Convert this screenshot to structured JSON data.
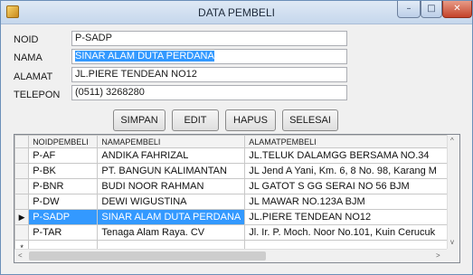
{
  "window": {
    "title": "DATA PEMBELI",
    "min_glyph": "–",
    "max_glyph": "□",
    "close_glyph": "✕",
    "icon": "form-icon"
  },
  "form": {
    "noid_label": "NOID",
    "noid_value": "P-SADP",
    "nama_label": "NAMA",
    "nama_value": "SINAR ALAM DUTA PERDANA",
    "alamat_label": "ALAMAT",
    "alamat_value": "JL.PIERE TENDEAN NO12",
    "telepon_label": "TELEPON",
    "telepon_value": "(0511) 3268280"
  },
  "buttons": {
    "simpan": "SIMPAN",
    "edit": "EDIT",
    "hapus": "HAPUS",
    "selesai": "SELESAI"
  },
  "grid": {
    "columns": [
      "NOIDPEMBELI",
      "NAMAPEMBELI",
      "ALAMATPEMBELI"
    ],
    "rows": [
      [
        "P-AF",
        "ANDIKA FAHRIZAL",
        "JL.TELUK DALAMGG BERSAMA NO.34"
      ],
      [
        "P-BK",
        "PT. BANGUN KALIMANTAN",
        "JL Jend A Yani, Km. 6, 8 No. 98, Karang M"
      ],
      [
        "P-BNR",
        "BUDI NOOR RAHMAN",
        "JL GATOT S GG SERAI NO 56 BJM"
      ],
      [
        "P-DW",
        "DEWI WIGUSTINA",
        "JL MAWAR NO.123A BJM"
      ],
      [
        "P-SADP",
        "SINAR ALAM DUTA PERDANA",
        "JL.PIERE TENDEAN NO12"
      ],
      [
        "P-TAR",
        "Tenaga Alam Raya. CV",
        "Jl. Ir. P. Moch. Noor No.101, Kuin Cerucuk"
      ]
    ],
    "current_row_marker": "▶",
    "new_row_marker": "*",
    "colors": {
      "selection": "#3399ff"
    }
  }
}
